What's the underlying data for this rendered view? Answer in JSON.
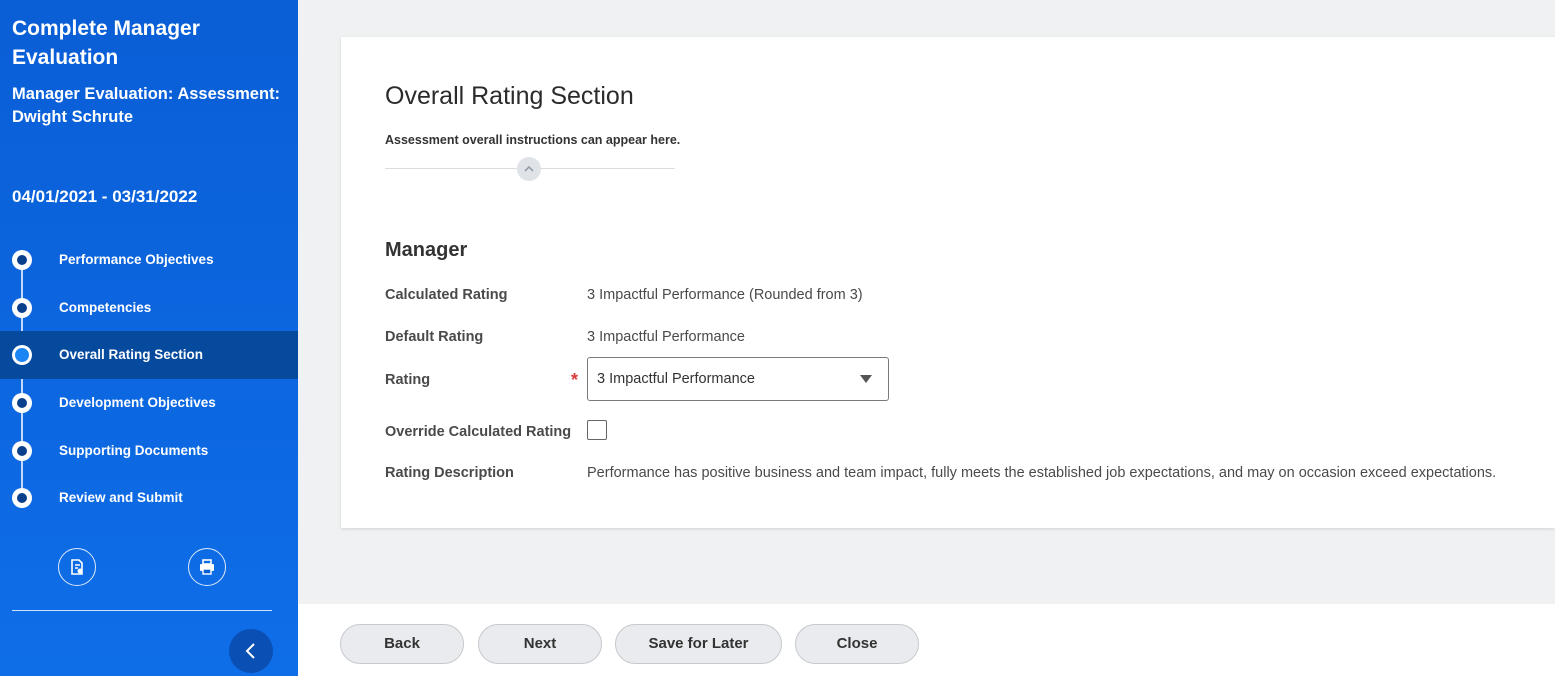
{
  "sidebar": {
    "title": "Complete Manager Evaluation",
    "subtitle": "Manager Evaluation: Assessment: Dwight Schrute",
    "date_range": "04/01/2021 - 03/31/2022",
    "steps": [
      {
        "label": "Performance Objectives",
        "active": false
      },
      {
        "label": "Competencies",
        "active": false
      },
      {
        "label": "Overall Rating Section",
        "active": true
      },
      {
        "label": "Development Objectives",
        "active": false
      },
      {
        "label": "Supporting Documents",
        "active": false
      },
      {
        "label": "Review and Submit",
        "active": false
      }
    ],
    "icons": [
      "document-attach-icon",
      "print-icon"
    ]
  },
  "main": {
    "section_title": "Overall Rating Section",
    "instructions": "Assessment overall instructions can appear here.",
    "group_title": "Manager",
    "fields": {
      "calculated_rating_label": "Calculated Rating",
      "calculated_rating_value": "3 Impactful Performance (Rounded from 3)",
      "default_rating_label": "Default Rating",
      "default_rating_value": "3 Impactful Performance",
      "rating_label": "Rating",
      "rating_selected": "3 Impactful Performance",
      "override_label": "Override Calculated Rating",
      "override_checked": false,
      "description_label": "Rating Description",
      "description_value": "Performance has positive business and team impact, fully meets the established job expectations, and may on occasion exceed expectations."
    },
    "required_mark": "*"
  },
  "footer": {
    "back": "Back",
    "next": "Next",
    "save_later": "Save for Later",
    "close": "Close"
  },
  "colors": {
    "sidebar_bg": "#0a5ed6",
    "active_step_bg": "#064a9e",
    "required": "#d83a3a"
  }
}
